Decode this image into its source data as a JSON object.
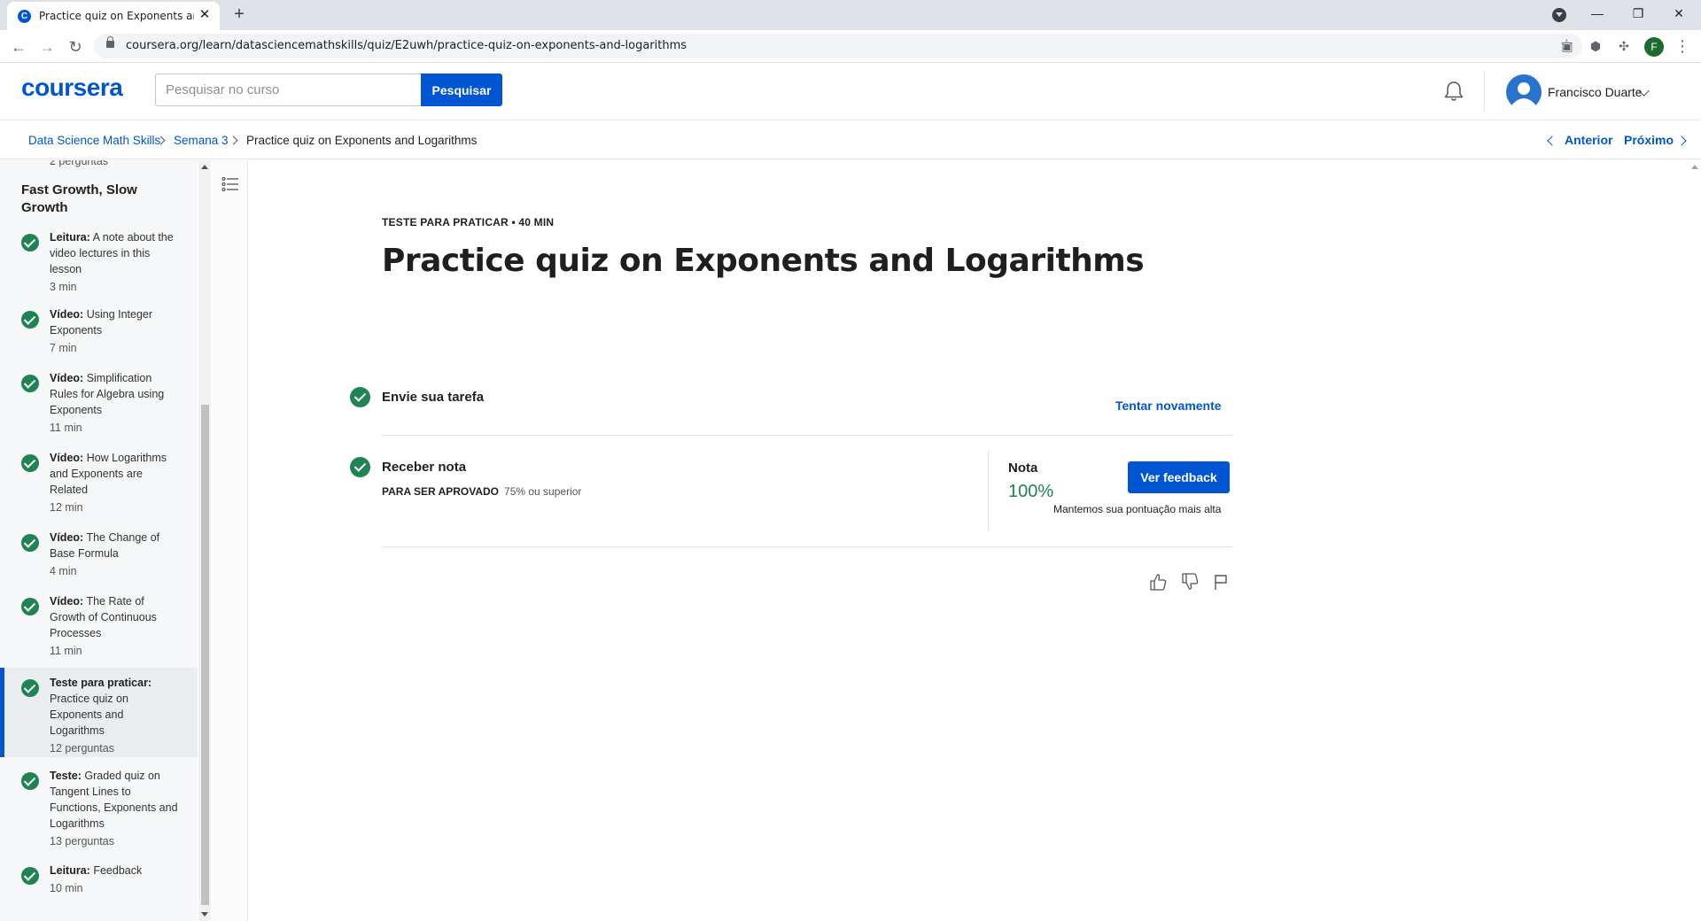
{
  "browser": {
    "tab_title": "Practice quiz on Exponents and L",
    "tab_favicon": "C",
    "url": "coursera.org/learn/datasciencemathskills/quiz/E2uwh/practice-quiz-on-exponents-and-logarithms",
    "profile_initial": "F"
  },
  "header": {
    "logo": "coursera",
    "search_placeholder": "Pesquisar no curso",
    "search_button": "Pesquisar",
    "user_name": "Francisco Duarte"
  },
  "breadcrumb": {
    "items": [
      "Data Science Math Skills",
      "Semana 3",
      "Practice quiz on Exponents and Logarithms"
    ],
    "prev": "Anterior",
    "next": "Próximo"
  },
  "sidebar": {
    "cut_text": "2 perguntas",
    "lesson_title": "Fast Growth, Slow Growth",
    "items": [
      {
        "type": "Leitura:",
        "title": "A note about the video lectures in this lesson",
        "meta": "3 min",
        "completed": true
      },
      {
        "type": "Vídeo:",
        "title": "Using Integer Exponents",
        "meta": "7 min",
        "completed": true
      },
      {
        "type": "Vídeo:",
        "title": "Simplification Rules for Algebra using Exponents",
        "meta": "11 min",
        "completed": true
      },
      {
        "type": "Vídeo:",
        "title": "How Logarithms and Exponents are Related",
        "meta": "12 min",
        "completed": true
      },
      {
        "type": "Vídeo:",
        "title": "The Change of Base Formula",
        "meta": "4 min",
        "completed": true
      },
      {
        "type": "Vídeo:",
        "title": "The Rate of Growth of Continuous Processes",
        "meta": "11 min",
        "completed": true
      },
      {
        "type": "Teste para praticar:",
        "title": "Practice quiz on Exponents and Logarithms",
        "meta": "12 perguntas",
        "completed": true,
        "active": true
      },
      {
        "type": "Teste:",
        "title": "Graded quiz on Tangent Lines to Functions, Exponents and Logarithms",
        "meta": "13 perguntas",
        "completed": true
      },
      {
        "type": "Leitura:",
        "title": "Feedback",
        "meta": "10 min",
        "completed": true
      }
    ]
  },
  "main": {
    "label": "TESTE PARA PRATICAR • 40 MIN",
    "title": "Practice quiz on Exponents and Logarithms",
    "step1_title": "Envie sua tarefa",
    "retry": "Tentar novamente",
    "step2_title": "Receber nota",
    "pass_label": "PARA SER APROVADO",
    "pass_value": "75% ou superior",
    "grade_label": "Nota",
    "grade_value": "100%",
    "grade_note": "Mantemos sua pontuação mais alta",
    "feedback_button": "Ver feedback"
  },
  "colors": {
    "brand": "#0056d2",
    "success": "#1f8354"
  },
  "icons": [
    "back-icon",
    "forward-icon",
    "reload-icon",
    "lock-icon",
    "star-icon",
    "bell-icon",
    "user-avatar-icon",
    "outline-icon",
    "thumbs-up-icon",
    "thumbs-down-icon",
    "flag-icon",
    "check-icon"
  ]
}
